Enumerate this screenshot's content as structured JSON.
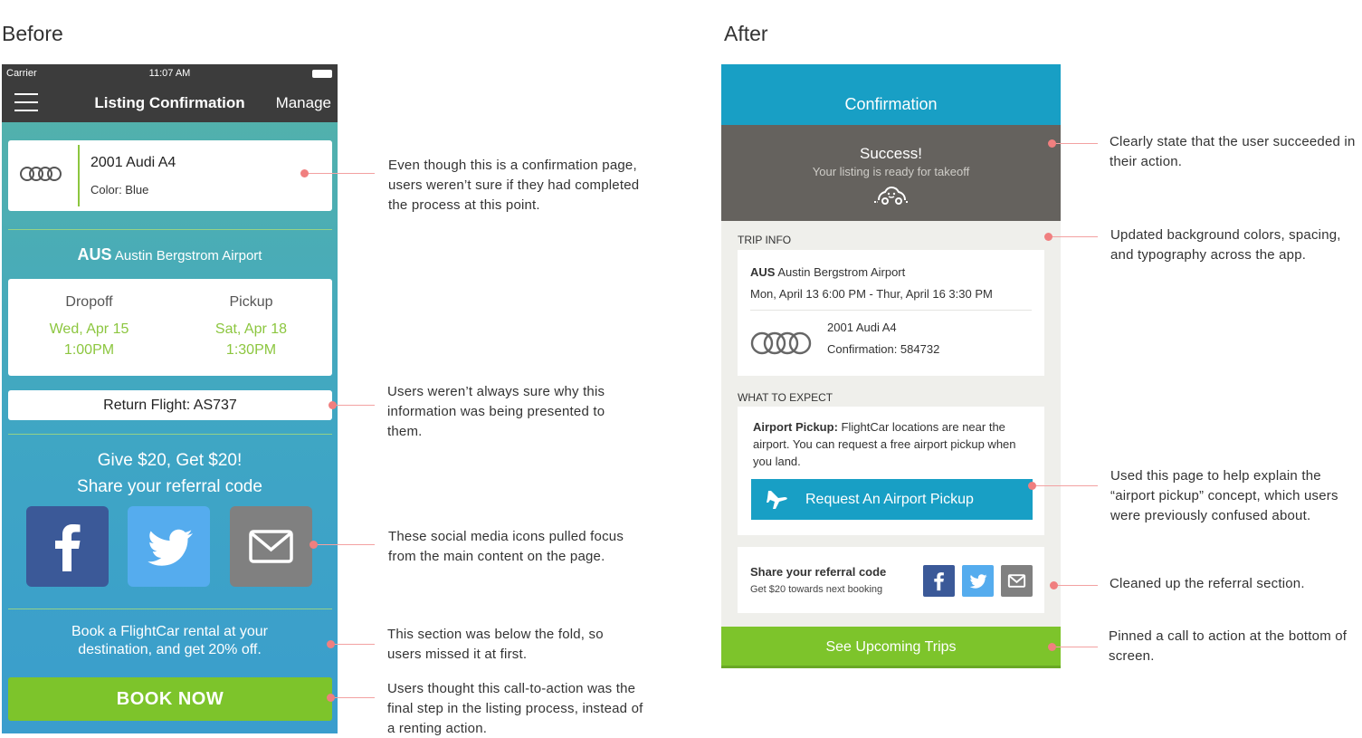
{
  "before": {
    "heading": "Before",
    "status": {
      "carrier": "Carrier",
      "time": "11:07 AM"
    },
    "nav": {
      "title": "Listing Confirmation",
      "manage": "Manage"
    },
    "car": {
      "name": "2001 Audi A4",
      "color": "Color: Blue"
    },
    "airport": {
      "code": "AUS",
      "name": "Austin Bergstrom Airport"
    },
    "dropoff": {
      "label": "Dropoff",
      "date": "Wed, Apr 15",
      "time": "1:00PM"
    },
    "pickup": {
      "label": "Pickup",
      "date": "Sat, Apr 18",
      "time": "1:30PM"
    },
    "return_flight": "Return Flight: AS737",
    "referral": {
      "line1": "Give $20, Get $20!",
      "line2": "Share your referral code"
    },
    "book_text": {
      "line1": "Book a FlightCar rental at your",
      "line2": "destination, and get 20% off."
    },
    "book_button": "BOOK NOW"
  },
  "after": {
    "heading": "After",
    "header_title": "Confirmation",
    "success": {
      "title": "Success!",
      "subtitle": "Your listing is ready for takeoff"
    },
    "trip_info_label": "TRIP INFO",
    "trip": {
      "airport_code": "AUS",
      "airport_name": "Austin Bergstrom Airport",
      "dates": "Mon, April 13 6:00 PM - Thur, April 16 3:30 PM",
      "car": "2001 Audi A4",
      "confirmation": "Confirmation: 584732"
    },
    "what_to_expect_label": "WHAT TO EXPECT",
    "expect": {
      "bold": "Airport Pickup:",
      "text": "FlightCar locations are near the airport. You can request a free airport pickup when you land.",
      "button": "Request An Airport Pickup"
    },
    "referral": {
      "title": "Share your referral code",
      "subtitle": "Get $20 towards next booking"
    },
    "cta": "See Upcoming Trips"
  },
  "annotations_before": [
    "Even though this is a confirmation page, users weren’t sure if they had completed the process at this point.",
    "Users weren’t always sure why this information was being presented to them.",
    "These social media icons pulled focus from the main content on the page.",
    "This section was below the fold, so users missed it at first.",
    "Users thought this call-to-action was the final step in the listing process, instead of a renting action."
  ],
  "annotations_after": [
    "Clearly state that the user succeeded in their action.",
    "Updated background colors, spacing, and typography across the app.",
    "Used this page to help explain the “airport pickup” concept, which users were previously confused about.",
    "Cleaned up the referral section.",
    "Pinned a call to action at the bottom of screen."
  ],
  "colors": {
    "accent_green": "#7dc42b",
    "accent_blue": "#189fc5",
    "facebook": "#3b5998",
    "twitter": "#55acee",
    "annotation": "#f07f7f"
  }
}
